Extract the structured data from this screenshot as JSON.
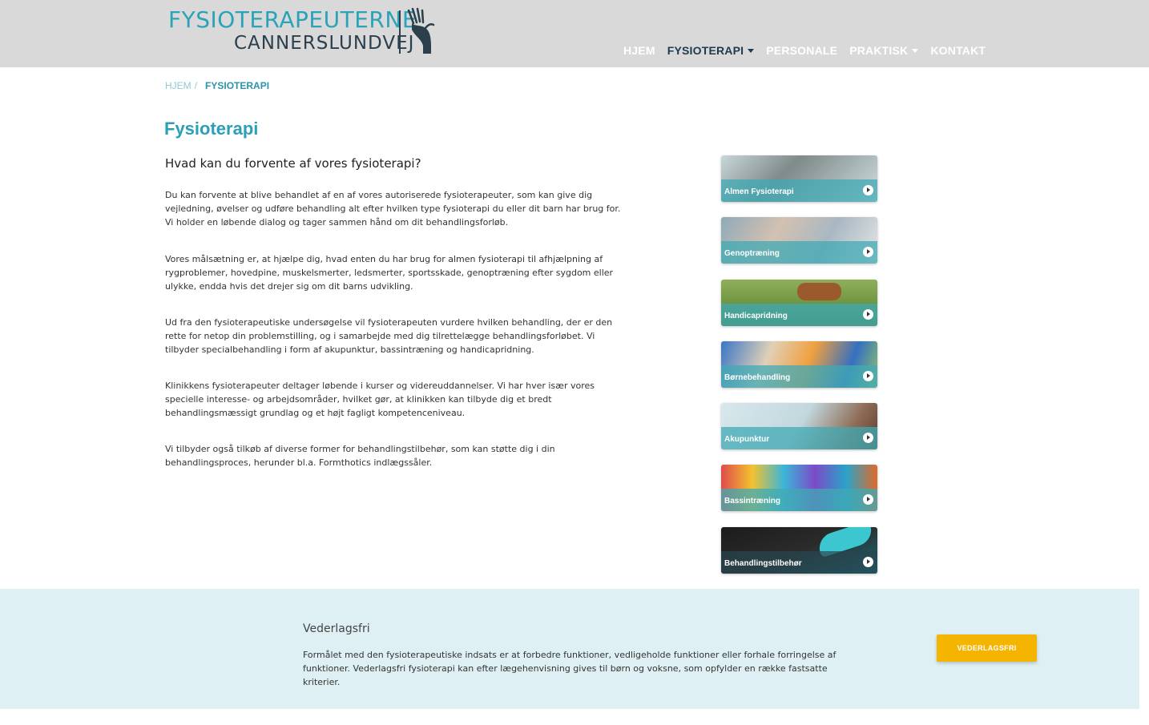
{
  "header": {
    "logo": {
      "line1": "FYSIOTERAPEUTERNE",
      "line2": "CANNERSLUNDVEJ"
    },
    "nav": [
      {
        "label": "HJEM",
        "active": false,
        "dropdown": false
      },
      {
        "label": "FYSIOTERAPI",
        "active": true,
        "dropdown": true
      },
      {
        "label": "PERSONALE",
        "active": false,
        "dropdown": false
      },
      {
        "label": "PRAKTISK",
        "active": false,
        "dropdown": true
      },
      {
        "label": "KONTAKT",
        "active": false,
        "dropdown": false
      }
    ]
  },
  "breadcrumb": {
    "home": "HJEM",
    "separator": "/",
    "current": "FYSIOTERAPI"
  },
  "main": {
    "title": "Fysioterapi",
    "subtitle": "Hvad kan du forvente af vores fysioterapi?",
    "paragraphs": [
      "Du kan forvente at blive behandlet af en af vores autoriserede fysioterapeuter, som kan give dig vejledning, øvelser og udføre behandling alt efter hvilken type fysioterapi du eller dit barn har brug for. Vi holder en løbende dialog og tager sammen hånd om dit behandlingsforløb.",
      "Vores målsætning er, at hjælpe dig, hvad enten du har brug for almen fysioterapi til afhjælpning af rygproblemer, hovedpine, muskelsmerter, ledsmerter, sportsskade, genoptræning efter sygdom eller ulykke, endda hvis det drejer sig om dit barns udvikling.",
      "Ud fra den fysioterapeutiske undersøgelse vil fysioterapeuten vurdere hvilken behandling, der er den rette for netop din problemstilling, og i samarbejde med dig tilrettelægge behandlingsforløbet. Vi tilbyder specialbehandling i form af akupunktur, bassintræning og handicapridning.",
      "Klinikkens fysioterapeuter deltager løbende i kurser og videreuddannelser. Vi har hver især vores specielle interesse- og arbejdsområder, hvilket gør, at klinikken kan tilbyde dig et bredt behandlingsmæssigt grundlag og et højt fagligt kompetenceniveau.",
      "Vi tilbyder også tilkøb af diverse former for behandlingstilbehør, som kan støtte dig i din behandlingsproces, herunder bl.a. Formthotics indlægssåler."
    ]
  },
  "sidebar": {
    "cards": [
      {
        "label": "Almen Fysioterapi"
      },
      {
        "label": "Genoptræning"
      },
      {
        "label": "Handicapridning"
      },
      {
        "label": "Børnebehandling"
      },
      {
        "label": "Akupunktur"
      },
      {
        "label": "Bassintræning"
      },
      {
        "label": "Behandlingstilbehør"
      }
    ]
  },
  "band": {
    "title": "Vederlagsfri",
    "text": "Formålet med den fysioterapeutiske indsats er at forbedre funktioner, vedligeholde funktioner eller forhale forringelse af funktioner. Vederlagsfri fysioterapi kan efter lægehenvisning gives til børn og voksne, som opfylder en række fastsatte kriterier.",
    "button": "VEDERLAGSFRI"
  },
  "colors": {
    "header_bg": "#d9d9d9",
    "brand_teal": "#2aa3b8",
    "brand_dark": "#1e3a4c",
    "band_bg": "#dff0f4",
    "button_yellow": "#f5b400"
  }
}
